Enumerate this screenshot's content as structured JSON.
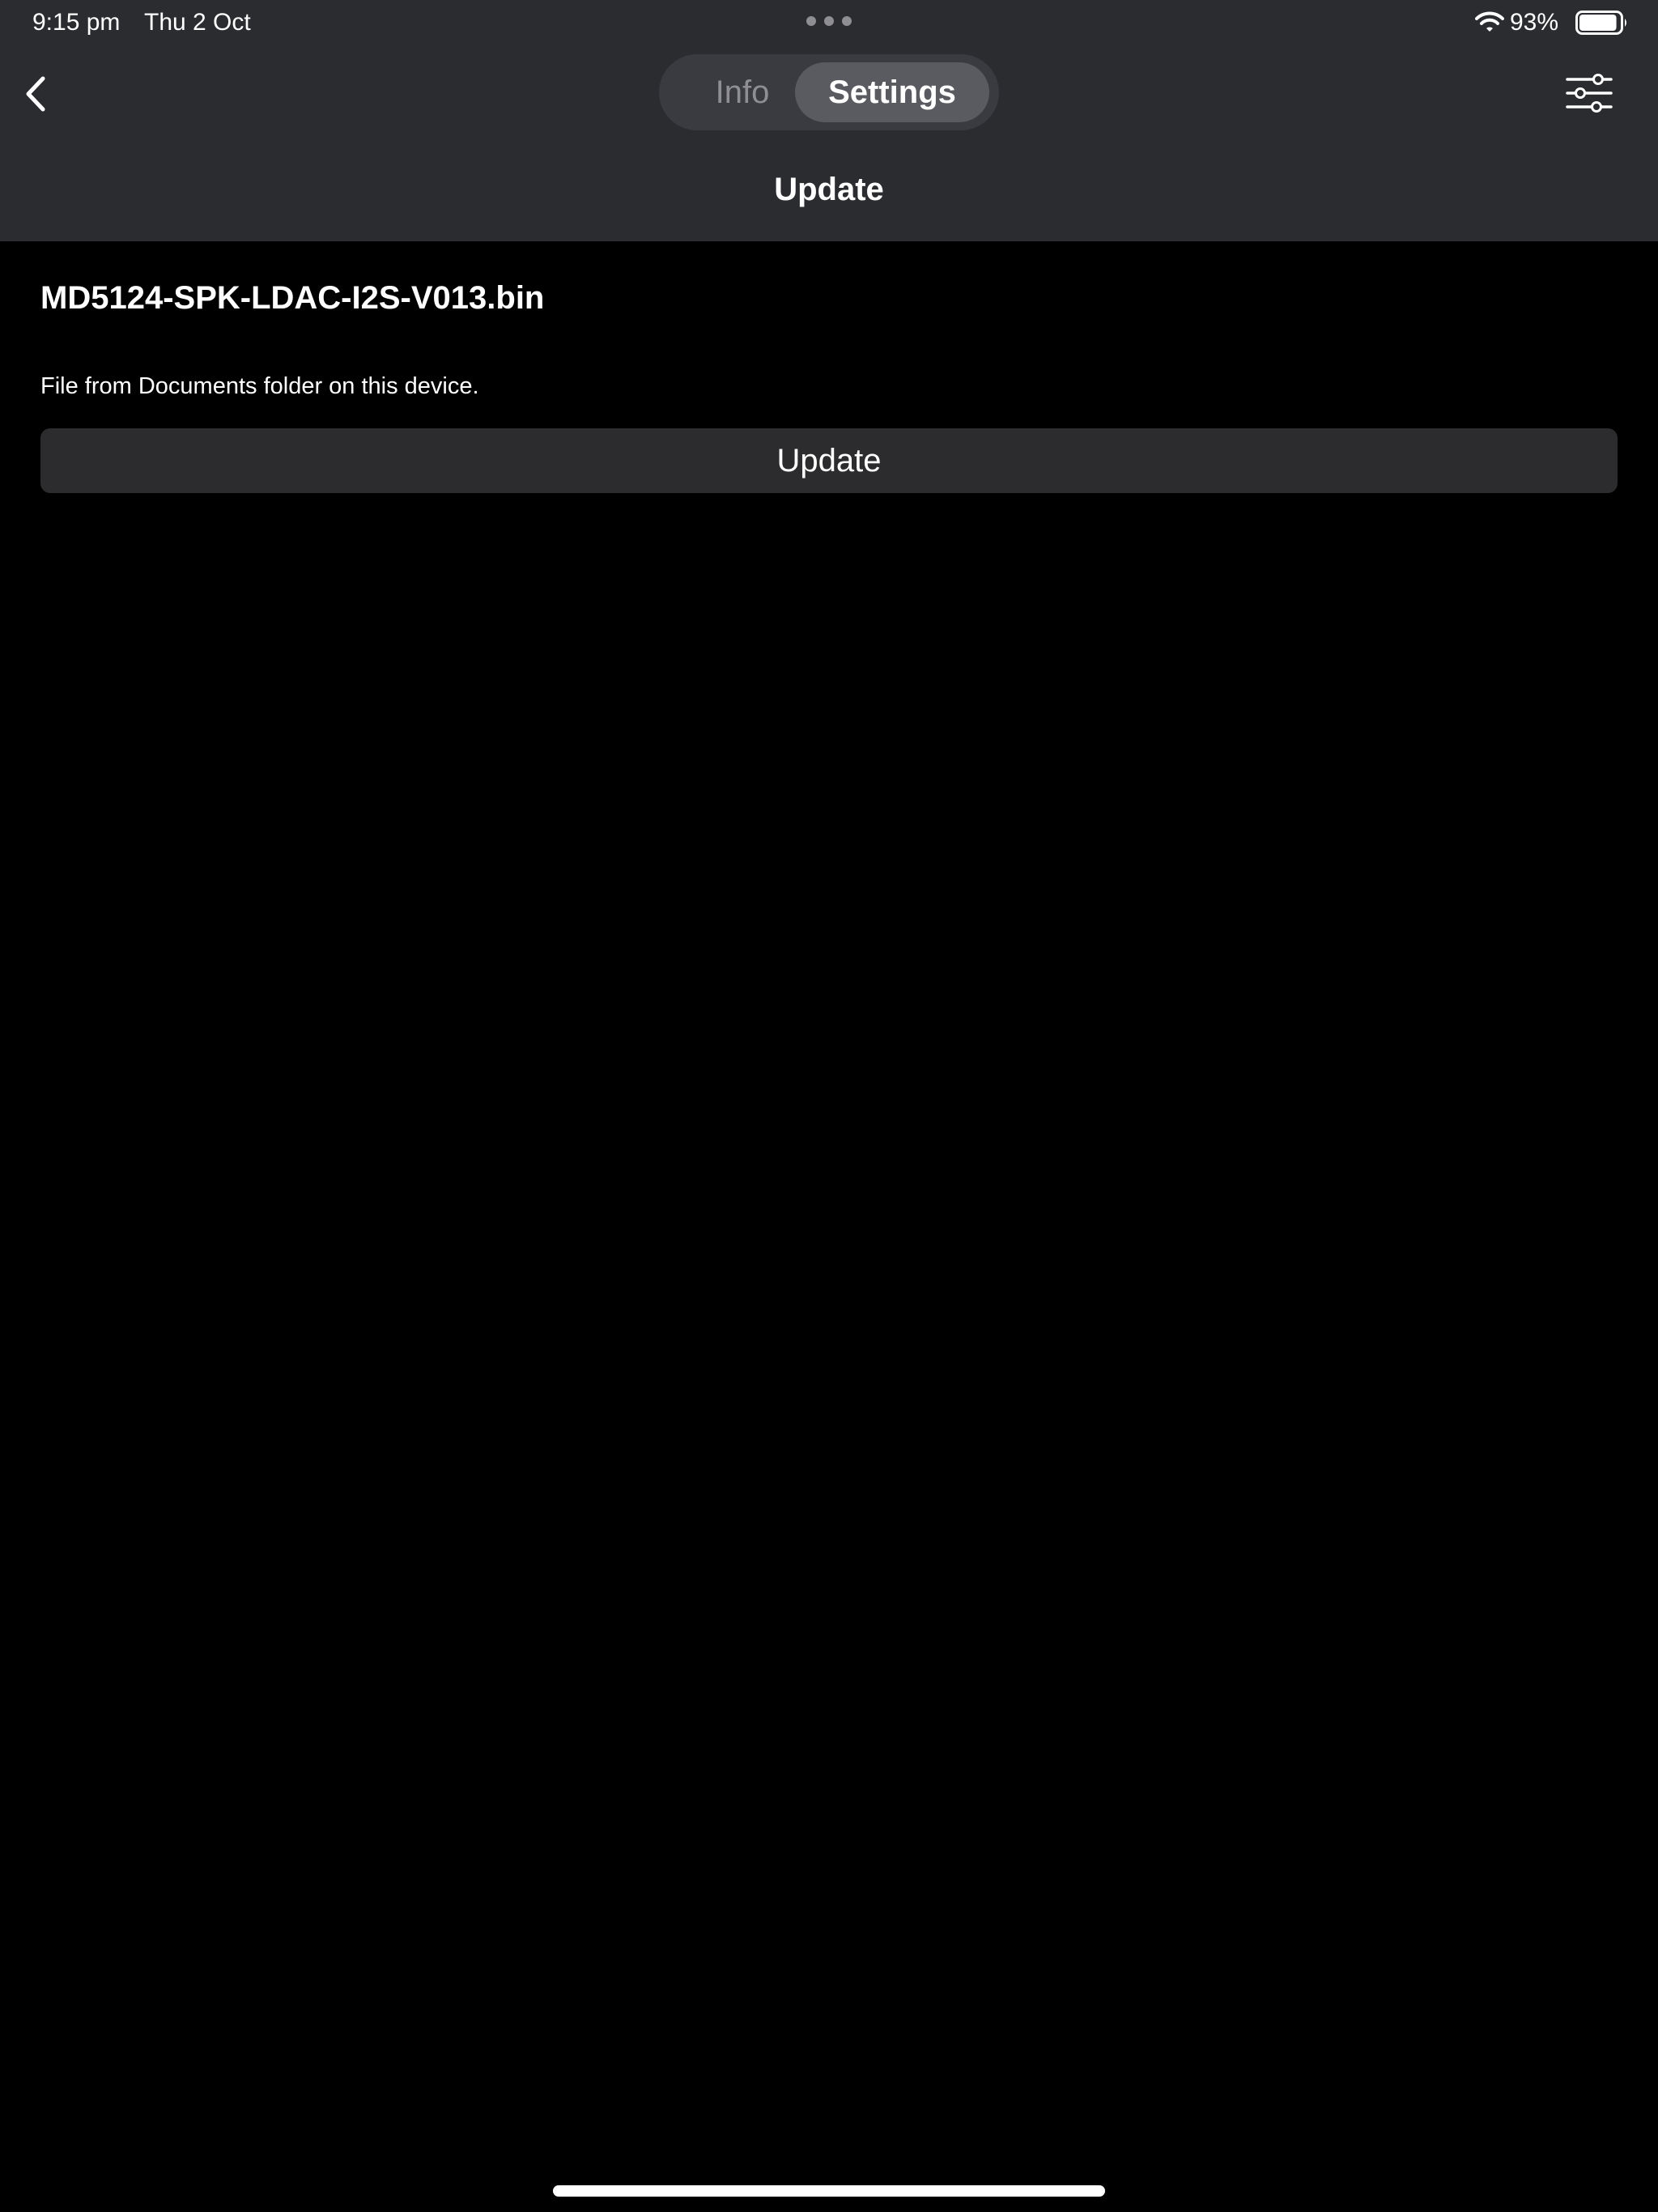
{
  "status_bar": {
    "time": "9:15 pm",
    "date": "Thu 2 Oct",
    "battery_percent": "93%",
    "battery_level": 0.93,
    "wifi_icon": "wifi-icon",
    "battery_icon": "battery-icon"
  },
  "nav": {
    "back_icon": "chevron-left-icon",
    "tabs": [
      {
        "label": "Info",
        "selected": false
      },
      {
        "label": "Settings",
        "selected": true
      }
    ],
    "filter_icon": "sliders-icon",
    "title": "Update"
  },
  "content": {
    "file_name": "MD5124-SPK-LDAC-I2S-V013.bin",
    "file_source": "File from Documents folder on this device.",
    "update_button_label": "Update"
  },
  "colors": {
    "bar_background": "#2b2c30",
    "page_background": "#000000",
    "segment_selected": "#5a5b60",
    "button_background": "#2c2c2e",
    "muted_text": "#8e8e93"
  }
}
